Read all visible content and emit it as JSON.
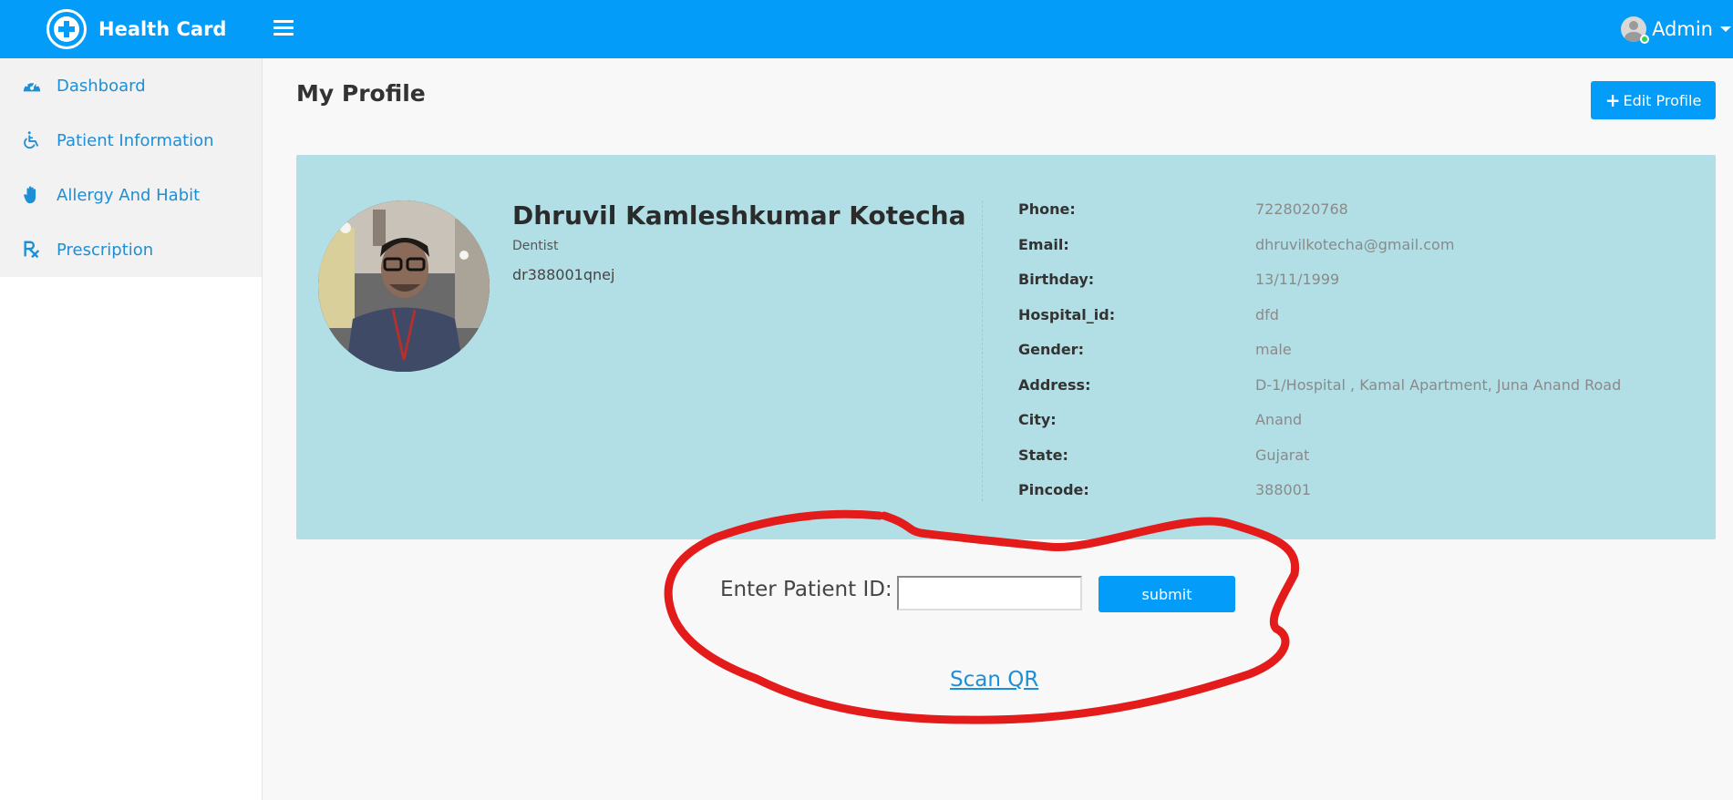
{
  "header": {
    "brand": "Health Card",
    "user_name": "Admin",
    "accent_color": "#039cf9"
  },
  "sidebar": {
    "items": [
      {
        "label": "Dashboard",
        "icon": "dashboard-gauge-icon"
      },
      {
        "label": "Patient Information",
        "icon": "wheelchair-icon"
      },
      {
        "label": "Allergy And Habit",
        "icon": "hand-icon"
      },
      {
        "label": "Prescription",
        "icon": "prescription-rx-icon"
      }
    ]
  },
  "main": {
    "title": "My Profile",
    "edit_button": "Edit Profile"
  },
  "profile": {
    "name": "Dhruvil Kamleshkumar Kotecha",
    "role": "Dentist",
    "id": "dr388001qnej",
    "details": [
      {
        "label": "Phone:",
        "value": "7228020768"
      },
      {
        "label": "Email:",
        "value": "dhruvilkotecha@gmail.com"
      },
      {
        "label": "Birthday:",
        "value": "13/11/1999"
      },
      {
        "label": "Hospital_id:",
        "value": "dfd"
      },
      {
        "label": "Gender:",
        "value": "male"
      },
      {
        "label": "Address:",
        "value": "D-1/Hospital , Kamal Apartment, Juna Anand Road"
      },
      {
        "label": "City:",
        "value": "Anand"
      },
      {
        "label": "State:",
        "value": "Gujarat"
      },
      {
        "label": "Pincode:",
        "value": "388001"
      }
    ]
  },
  "patient_form": {
    "label": "Enter Patient ID:",
    "input_value": "",
    "submit_label": "submit",
    "scan_link": "Scan QR"
  }
}
